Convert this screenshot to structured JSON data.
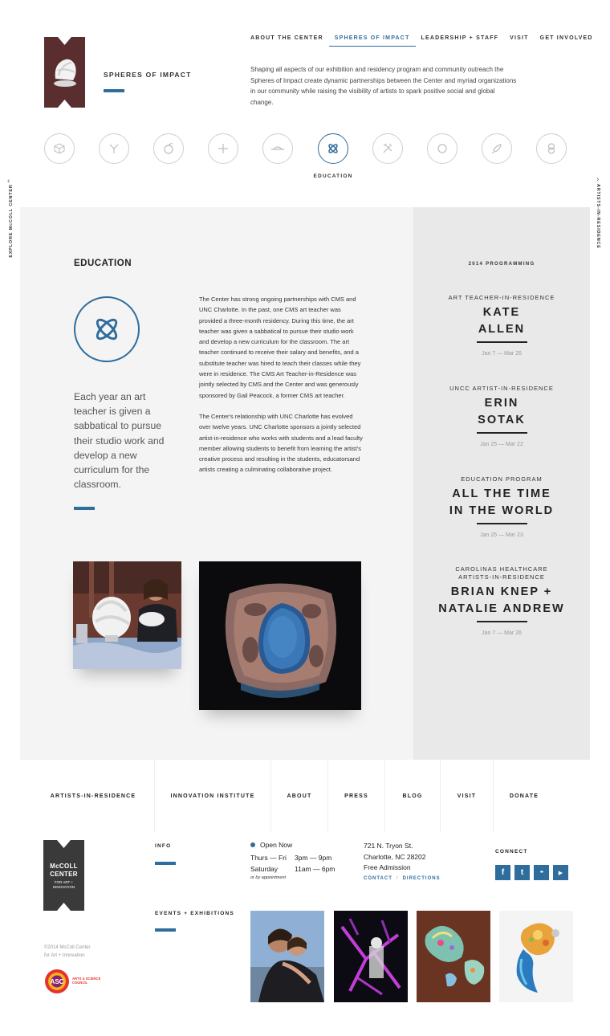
{
  "header": {
    "page_label": "SPHERES OF IMPACT",
    "intro": "Shaping all aspects of our exhibition and residency program and community outreach the Spheres of Impact create dynamic partnerships between the Center and myriad organizations in our community while raising the visibility of artists to spark positive social and global change."
  },
  "nav": [
    {
      "label": "ABOUT THE CENTER",
      "active": false
    },
    {
      "label": "SPHERES OF IMPACT",
      "active": true
    },
    {
      "label": "LEADERSHIP + STAFF",
      "active": false
    },
    {
      "label": "VISIT",
      "active": false
    },
    {
      "label": "GET INVOLVED",
      "active": false
    }
  ],
  "spheres": {
    "active_caption": "EDUCATION",
    "icons": [
      "cube-sphere-icon",
      "y-branch-sphere-icon",
      "leaf-sphere-icon",
      "plus-sphere-icon",
      "horizon-sphere-icon",
      "atom-sphere-icon",
      "tools-sphere-icon",
      "circle-sphere-icon",
      "rocket-sphere-icon",
      "link-sphere-icon"
    ]
  },
  "side": {
    "left": "EXPLORE McCOLL CENTER",
    "right": "ARTISTS-IN-RESIDENCE"
  },
  "education": {
    "title": "EDUCATION",
    "quote": "Each year an art teacher is given a sabbatical to pursue their studio work and develop a new curriculum for the classroom.",
    "p1": "The Center has strong ongoing partnerships with CMS and UNC Charlotte. In the past, one CMS art teacher was provided a three-month residency. During this time, the art teacher was given a sabbatical to pursue their studio work and develop a new curriculum for the classroom. The art teacher continued to receive their salary and benefits, and a substitute teacher was hired to teach their classes while they were in residence. The CMS Art Teacher-in-Residence was jointly selected by CMS and the Center and was generously sponsored by Gail Peacock, a former CMS art teacher.",
    "p2": "The Center's relationship with UNC Charlotte has evolved over twelve years. UNC Charlotte sponsors a jointly selected artist-in-residence who works with students and a lead faculty member allowing students to benefit from learning the artist's creative process and resulting in the students, educatorsand artists creating a culminating collaborative project."
  },
  "programming": {
    "heading": "2014 PROGRAMMING",
    "items": [
      {
        "sub1": "ART TEACHER-IN-RESIDENCE",
        "sub2": "",
        "name1": "KATE",
        "name2": "ALLEN",
        "date": "Jan 7 — Mar 26"
      },
      {
        "sub1": "UNCC ARTIST-IN-RESIDENCE",
        "sub2": "",
        "name1": "ERIN",
        "name2": "SOTAK",
        "date": "Jan 25 — Mar 22"
      },
      {
        "sub1": "EDUCATION PROGRAM",
        "sub2": "",
        "name1": "ALL THE TIME",
        "name2": "IN THE WORLD",
        "date": "Jan 25 — Mar 23"
      },
      {
        "sub1": "CAROLINAS HEALTHCARE",
        "sub2": "ARTISTS-IN-RESIDENCE",
        "name1": "BRIAN KNEP +",
        "name2": "NATALIE ANDREW",
        "date": "Jan 7 — Mar 26"
      }
    ]
  },
  "footer_nav": [
    "ARTISTS-IN-RESIDENCE",
    "INNOVATION INSTITUTE",
    "ABOUT",
    "PRESS",
    "BLOG",
    "VISIT",
    "DONATE"
  ],
  "footer": {
    "logo_line1": "McCOLL",
    "logo_line2": "CENTER",
    "logo_line3": "FOR ART +",
    "logo_line4": "INNOVATION",
    "copyright1": "©2014 McColl Center",
    "copyright2": "for Art + Innovation",
    "asc_label": "ASC",
    "asc_text1": "ARTS & SCIENCE",
    "asc_text2": "COUNCIL",
    "info_label": "INFO",
    "events_label": "EVENTS + EXHIBITIONS",
    "open_now": "Open Now",
    "hours": [
      {
        "day": "Thurs — Fri",
        "time": "3pm — 9pm"
      },
      {
        "day": "Saturday",
        "time": "11am — 6pm"
      }
    ],
    "by_appt": "or by appointment",
    "address": [
      "721 N. Tryon St.",
      "Charlotte, NC 28202",
      "Free Admission"
    ],
    "contact_link": "CONTACT",
    "directions_link": "DIRECTIONS",
    "connect_label": "CONNECT",
    "social": [
      {
        "name": "facebook-icon",
        "glyph": "f"
      },
      {
        "name": "twitter-icon",
        "glyph": "t"
      },
      {
        "name": "flickr-icon",
        "glyph": "••"
      },
      {
        "name": "youtube-icon",
        "glyph": "▶"
      }
    ]
  },
  "colors": {
    "accent": "#2f6d9d",
    "panel": "#f4f4f4",
    "side_panel": "#e9e9e9"
  }
}
